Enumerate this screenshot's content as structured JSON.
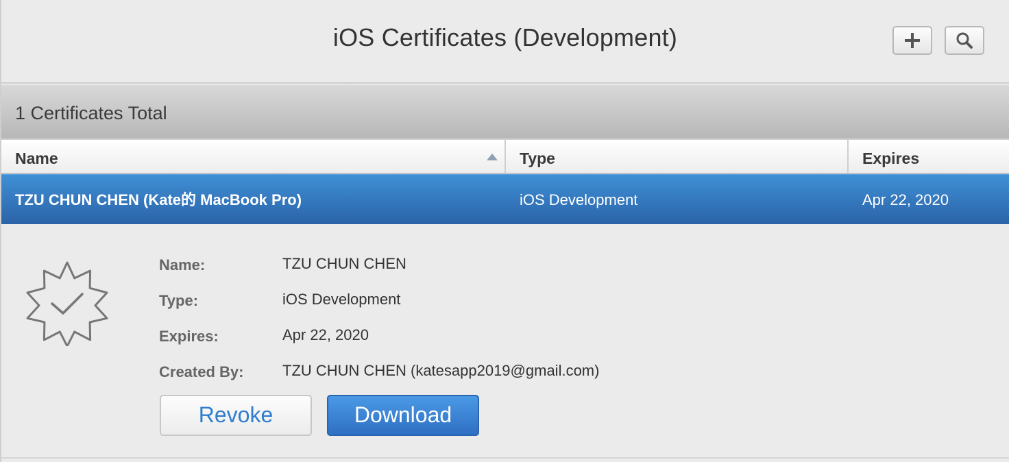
{
  "header": {
    "title": "iOS Certificates (Development)",
    "add_icon": "plus-icon",
    "search_icon": "search-icon"
  },
  "summary": {
    "total_text": "1 Certificates Total"
  },
  "table": {
    "columns": [
      "Name",
      "Type",
      "Expires"
    ],
    "sort_column": "Name",
    "sort_direction": "ascending",
    "rows": [
      {
        "name": "TZU CHUN CHEN (Kate的 MacBook Pro)",
        "type": "iOS Development",
        "expires": "Apr 22, 2020",
        "selected": true
      }
    ]
  },
  "detail": {
    "icon": "certificate-badge-icon",
    "fields": [
      {
        "label": "Name:",
        "value": "TZU CHUN CHEN"
      },
      {
        "label": "Type:",
        "value": "iOS Development"
      },
      {
        "label": "Expires:",
        "value": "Apr 22, 2020"
      },
      {
        "label": "Created By:",
        "value": "TZU CHUN CHEN (katesapp2019@gmail.com)"
      }
    ],
    "revoke_label": "Revoke",
    "download_label": "Download"
  },
  "colors": {
    "selected_row_top": "#3f8fd6",
    "selected_row_bottom": "#2b63a7",
    "accent_blue": "#2f7dcf",
    "background": "#ebebeb"
  }
}
